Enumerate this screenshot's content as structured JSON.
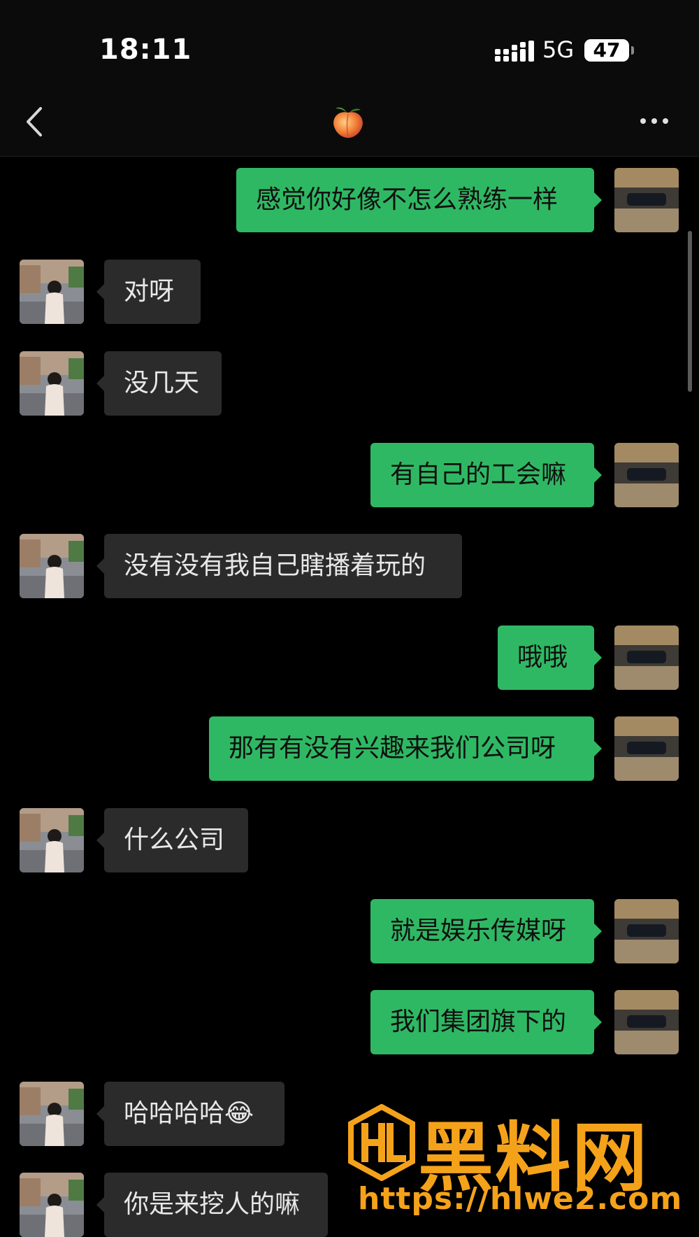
{
  "status_bar": {
    "time": "18:11",
    "network": "5G",
    "battery": "47"
  },
  "nav": {
    "title_icon": "peach-icon",
    "back_icon": "chevron-left-icon",
    "more_icon": "more-dots-icon"
  },
  "colors": {
    "my_bubble": "#2fb863",
    "their_bubble": "#2b2b2b",
    "background": "#000000",
    "watermark": "#f5a21b"
  },
  "messages": [
    {
      "sender": "me",
      "text": "感觉你好像不怎么熟练一样"
    },
    {
      "sender": "them",
      "text": "对呀"
    },
    {
      "sender": "them",
      "text": "没几天"
    },
    {
      "sender": "me",
      "text": "有自己的工会嘛"
    },
    {
      "sender": "them",
      "text": "没有没有我自己瞎播着玩的"
    },
    {
      "sender": "me",
      "text": "哦哦"
    },
    {
      "sender": "me",
      "text": "那有有没有兴趣来我们公司呀"
    },
    {
      "sender": "them",
      "text": "什么公司"
    },
    {
      "sender": "me",
      "text": "就是娱乐传媒呀"
    },
    {
      "sender": "me",
      "text": "我们集团旗下的"
    },
    {
      "sender": "them",
      "text": "哈哈哈哈😂"
    },
    {
      "sender": "them",
      "text": "你是来挖人的嘛"
    }
  ],
  "watermark": {
    "brand": "黑料网",
    "url": "https://hlwe2.com"
  }
}
